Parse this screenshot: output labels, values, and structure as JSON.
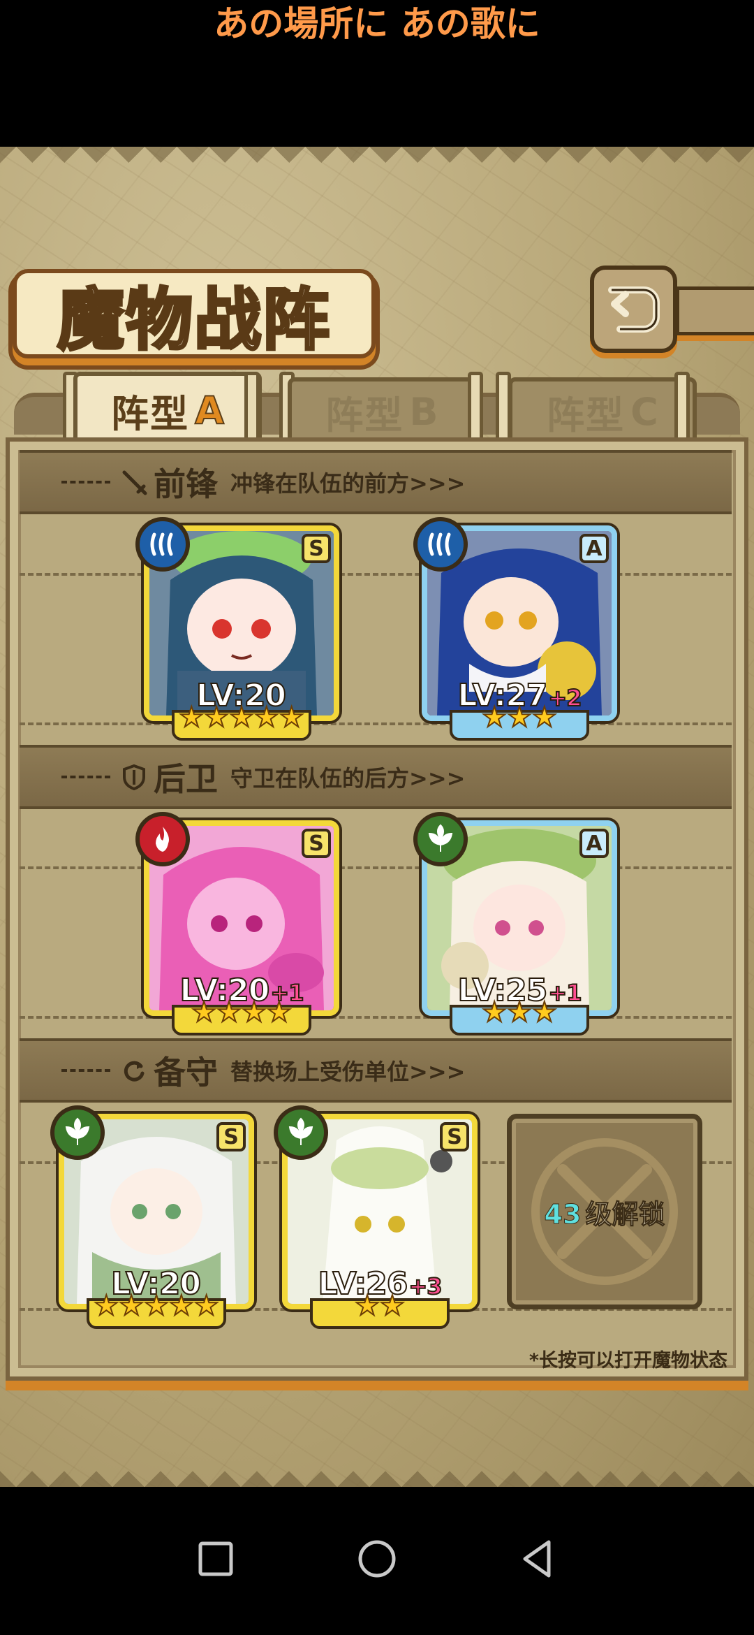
{
  "subtitle": "あの場所に あの歌に",
  "title": "魔物战阵",
  "tabs": [
    {
      "label": "阵型",
      "letter": "A",
      "active": true
    },
    {
      "label": "阵型",
      "letter": "B",
      "active": false
    },
    {
      "label": "阵型",
      "letter": "C",
      "active": false
    }
  ],
  "sections": {
    "front": {
      "title": "前锋",
      "desc": "冲锋在队伍的前方>>>",
      "icon": "sword-icon"
    },
    "rear": {
      "title": "后卫",
      "desc": "守卫在队伍的后方>>>",
      "icon": "shield-icon"
    },
    "reserve": {
      "title": "备守",
      "desc": "替换场上受伤单位>>>",
      "icon": "swap-icon"
    }
  },
  "units": {
    "front": [
      {
        "level": "LV:20",
        "bonus": "",
        "grade": "S",
        "element": "water",
        "stars": 5
      },
      {
        "level": "LV:27",
        "bonus": "+2",
        "grade": "A",
        "element": "water",
        "stars": 3
      }
    ],
    "rear": [
      {
        "level": "LV:20",
        "bonus": "+1",
        "grade": "S",
        "element": "fire",
        "stars": 4
      },
      {
        "level": "LV:25",
        "bonus": "+1",
        "grade": "A",
        "element": "wood",
        "stars": 3
      }
    ],
    "reserve": [
      {
        "level": "LV:20",
        "bonus": "",
        "grade": "S",
        "element": "wood",
        "stars": 5
      },
      {
        "level": "LV:26",
        "bonus": "+3",
        "grade": "S",
        "element": "wood",
        "stars": 2
      }
    ]
  },
  "locked_slot": {
    "level": "43",
    "text": "级解锁"
  },
  "hint": "*长按可以打开魔物状态",
  "colors": {
    "gold_frame": "#f3d83a",
    "blue_frame": "#8fd1ef",
    "accent_orange": "#d38427"
  }
}
